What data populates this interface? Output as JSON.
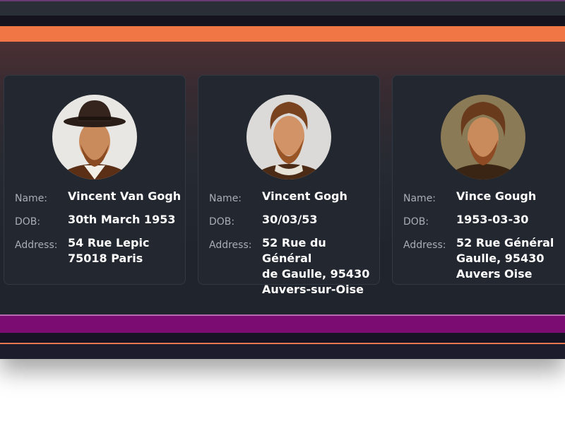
{
  "labels": {
    "name": "Name:",
    "dob": "DOB:",
    "address": "Address:"
  },
  "cards": [
    {
      "name": "Vincent Van Gogh",
      "dob": "30th March 1953",
      "address": "54 Rue Lepic\n75018 Paris",
      "avatar_icon": "portrait-hat"
    },
    {
      "name": "Vincent Gogh",
      "dob": "30/03/53",
      "address": "52 Rue du Général\nde Gaulle, 95430\nAuvers-sur-Oise",
      "avatar_icon": "portrait-ruff"
    },
    {
      "name": "Vince Gough",
      "dob": "1953-03-30",
      "address": "52 Rue Général\nGaulle, 95430\nAuvers Oise",
      "avatar_icon": "portrait-curly"
    }
  ],
  "colors": {
    "accent_orange": "#f07646",
    "accent_purple": "#7b0d72",
    "card_bg": "#222730",
    "page_bg": "#20252d"
  }
}
